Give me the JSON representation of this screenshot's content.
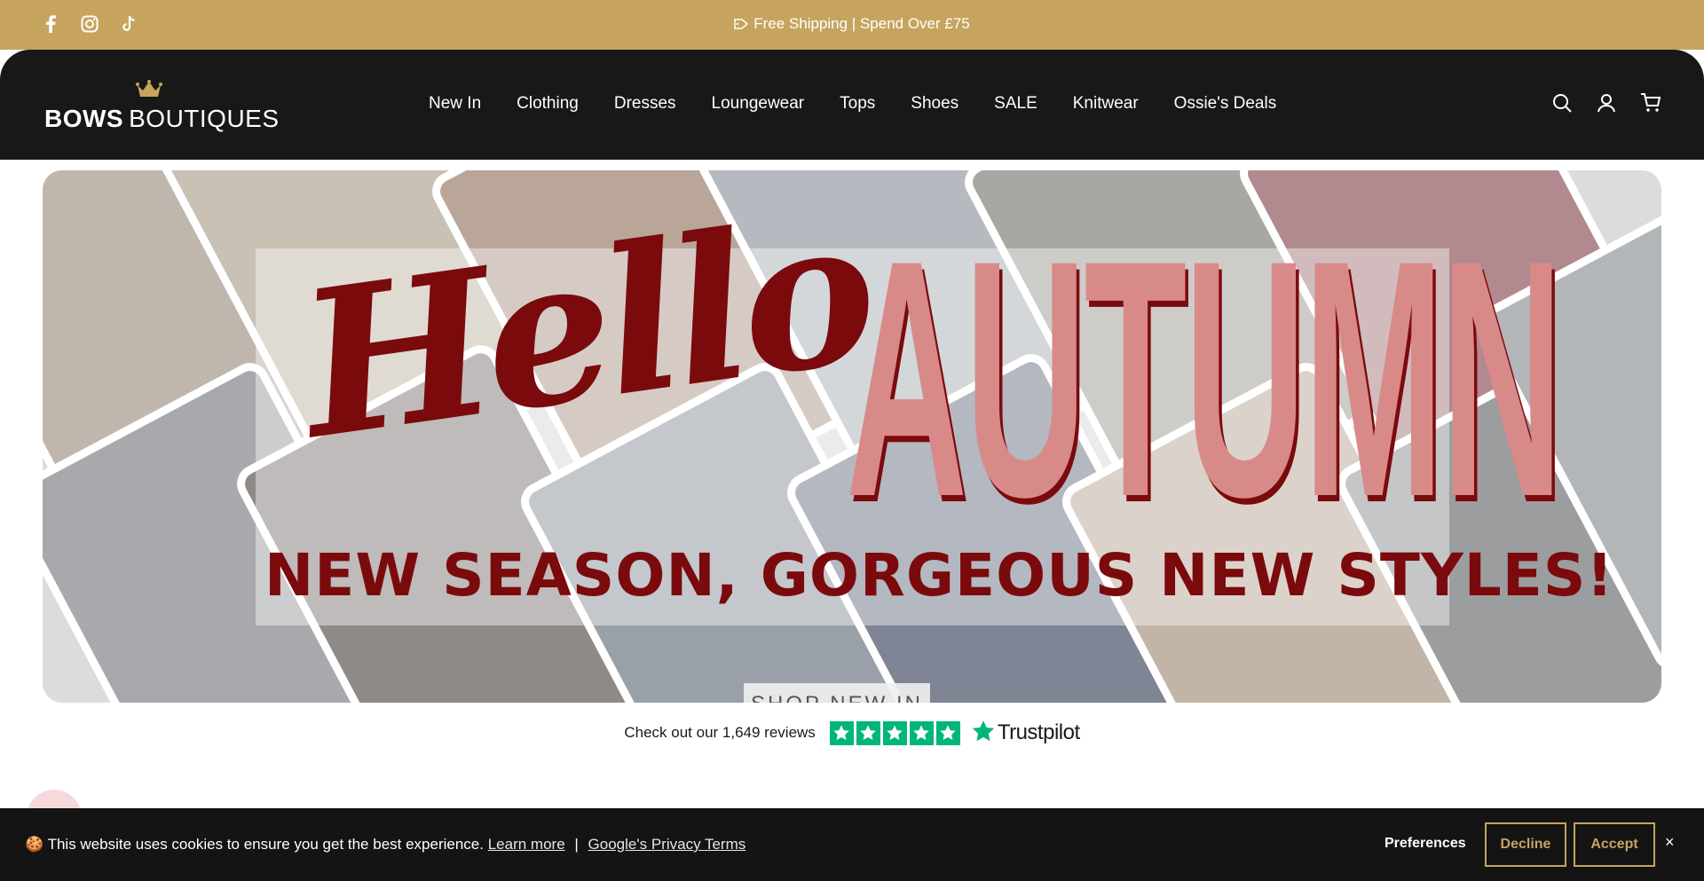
{
  "announcement": {
    "text": "Free Shipping | Spend Over £75",
    "social": [
      "facebook-icon",
      "instagram-icon",
      "tiktok-icon"
    ]
  },
  "header": {
    "logo_bold": "BOWS",
    "logo_light": "BOUTIQUES",
    "nav": [
      {
        "label": "New In"
      },
      {
        "label": "Clothing"
      },
      {
        "label": "Dresses"
      },
      {
        "label": "Loungewear"
      },
      {
        "label": "Tops"
      },
      {
        "label": "Shoes"
      },
      {
        "label": "SALE"
      },
      {
        "label": "Knitwear"
      },
      {
        "label": "Ossie's Deals"
      }
    ],
    "icons": [
      "search-icon",
      "account-icon",
      "cart-icon"
    ]
  },
  "hero": {
    "script": "Hello",
    "headline": "AUTUMN",
    "subline": "NEW SEASON, GORGEOUS NEW STYLES!",
    "button": "SHOP NEW IN"
  },
  "reviews": {
    "text": "Check out our 1,649 reviews",
    "brand": "Trustpilot",
    "rating_stars": 5
  },
  "cookie": {
    "text": "This website uses cookies to ensure you get the best experience.",
    "learn_more": "Learn more",
    "separator": "|",
    "privacy": "Google's Privacy Terms",
    "preferences": "Preferences",
    "decline": "Decline",
    "accept": "Accept",
    "close": "×"
  },
  "colors": {
    "gold": "#c6a45e",
    "header_bg": "#181818",
    "maroon": "#7b0a0d",
    "pink": "#d88a89",
    "trustpilot_green": "#00b67a"
  }
}
